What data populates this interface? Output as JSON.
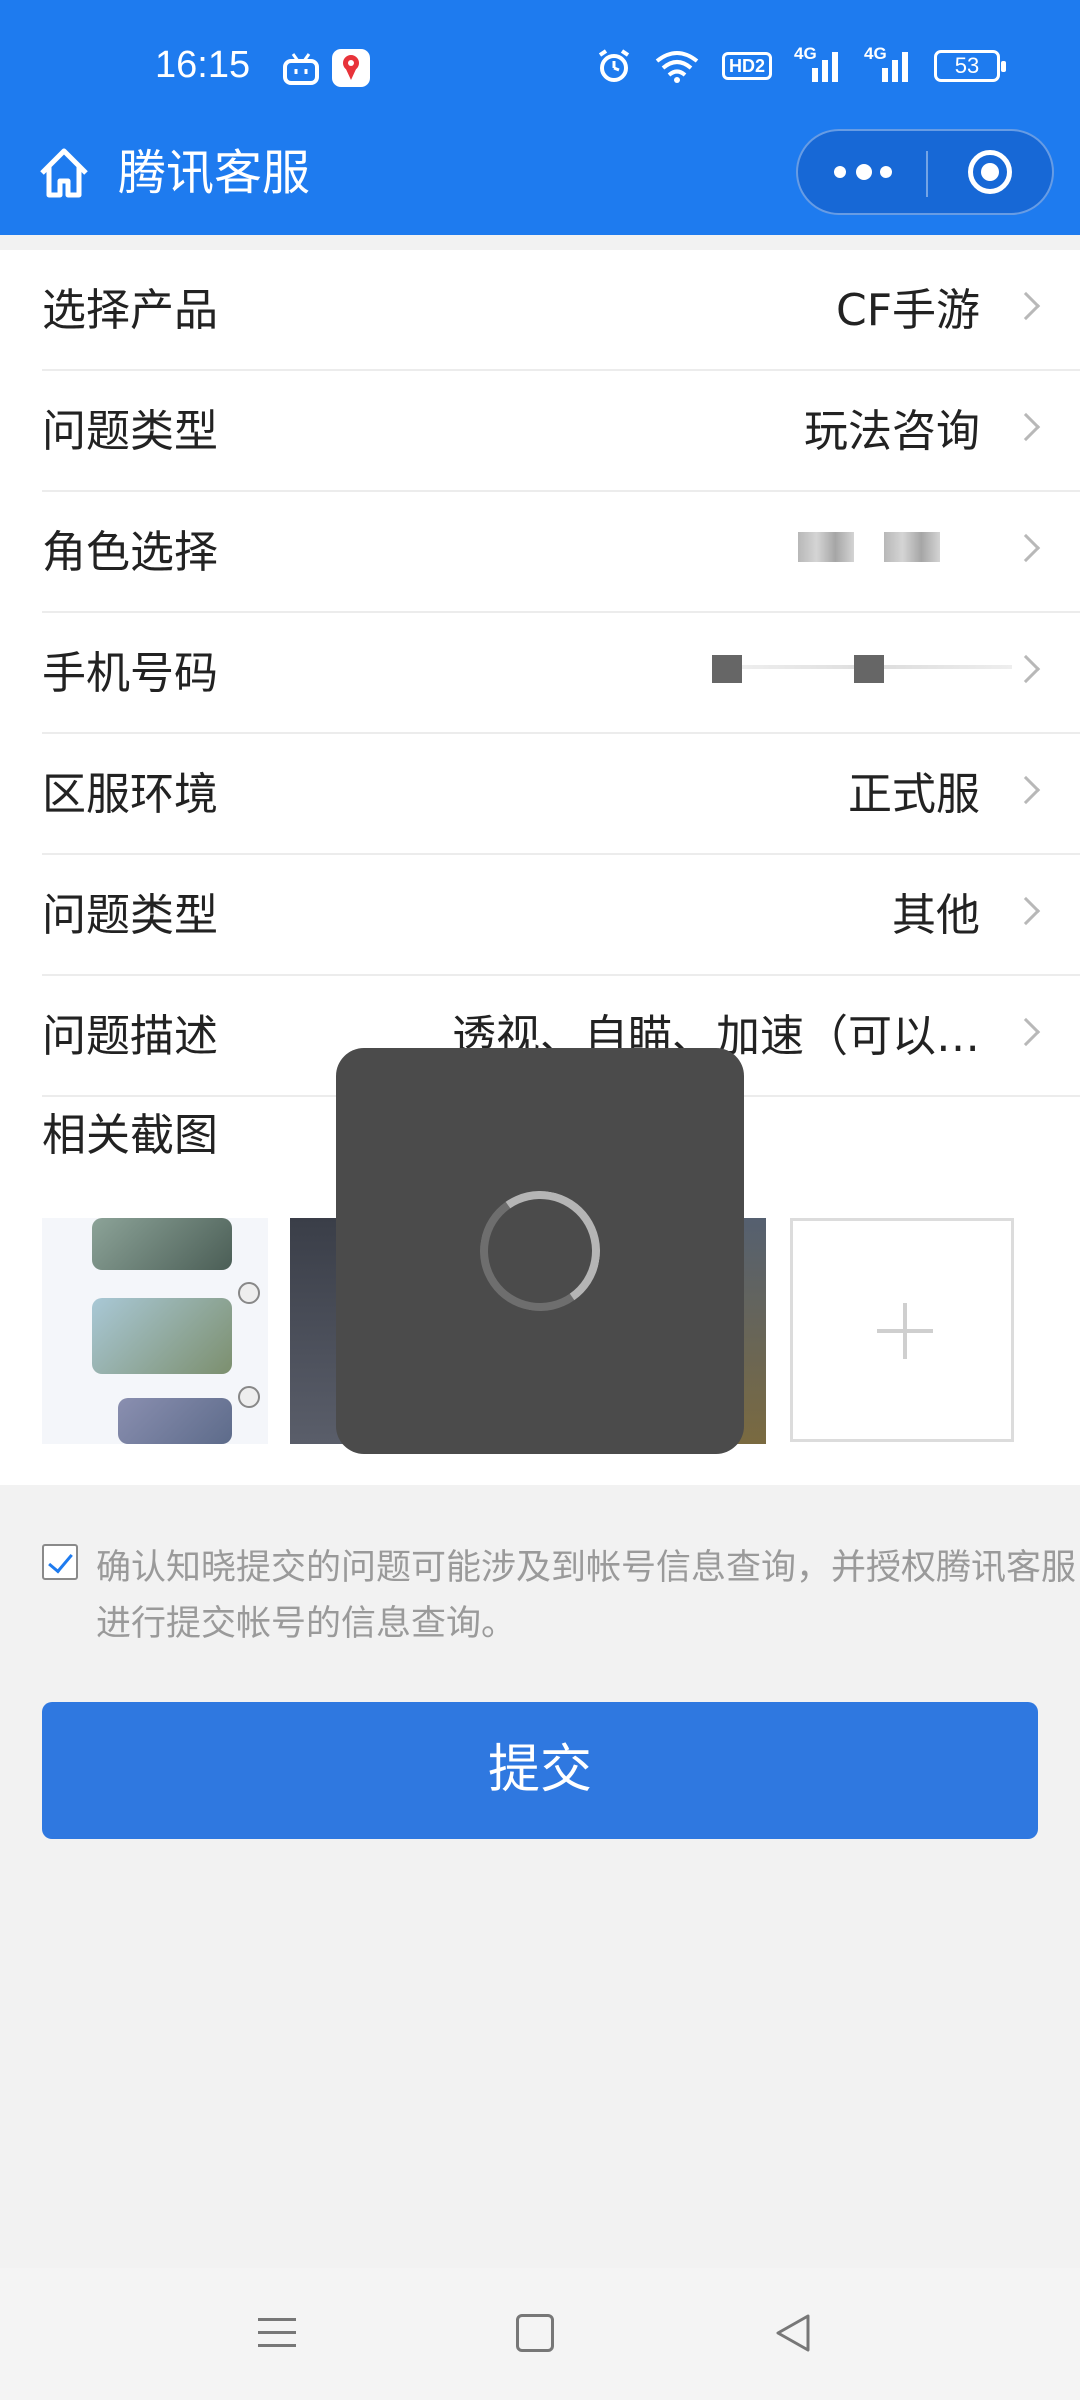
{
  "status_bar": {
    "time": "16:15",
    "network_1": "4G",
    "network_2": "4G",
    "hd_badge": "HD2",
    "battery": "53",
    "icons": [
      "tv-icon",
      "map-pin-icon",
      "alarm-icon",
      "wifi-icon",
      "signal-icon",
      "battery-icon"
    ]
  },
  "title_bar": {
    "title": "腾讯客服",
    "icons": [
      "home-icon",
      "more-icon",
      "target-icon"
    ]
  },
  "form": {
    "rows": [
      {
        "label": "选择产品",
        "value": "CF手游"
      },
      {
        "label": "问题类型",
        "value": "玩法咨询"
      },
      {
        "label": "角色选择",
        "value": ""
      },
      {
        "label": "手机号码",
        "value": ""
      },
      {
        "label": "区服环境",
        "value": "正式服"
      },
      {
        "label": "问题类型",
        "value": "其他"
      },
      {
        "label": "问题描述",
        "value": "透视、自瞄、加速（可以…"
      }
    ],
    "screenshots_label": "相关截图",
    "add_icon": "plus-icon"
  },
  "agreement": {
    "checked": true,
    "text": "确认知晓提交的问题可能涉及到帐号信息查询，并授权腾讯客服进行提交帐号的信息查询。"
  },
  "submit_label": "提交",
  "colors": {
    "header_blue": "#1e7bef",
    "button_blue": "#2f78e0",
    "overlay": "#4b4b4b"
  }
}
